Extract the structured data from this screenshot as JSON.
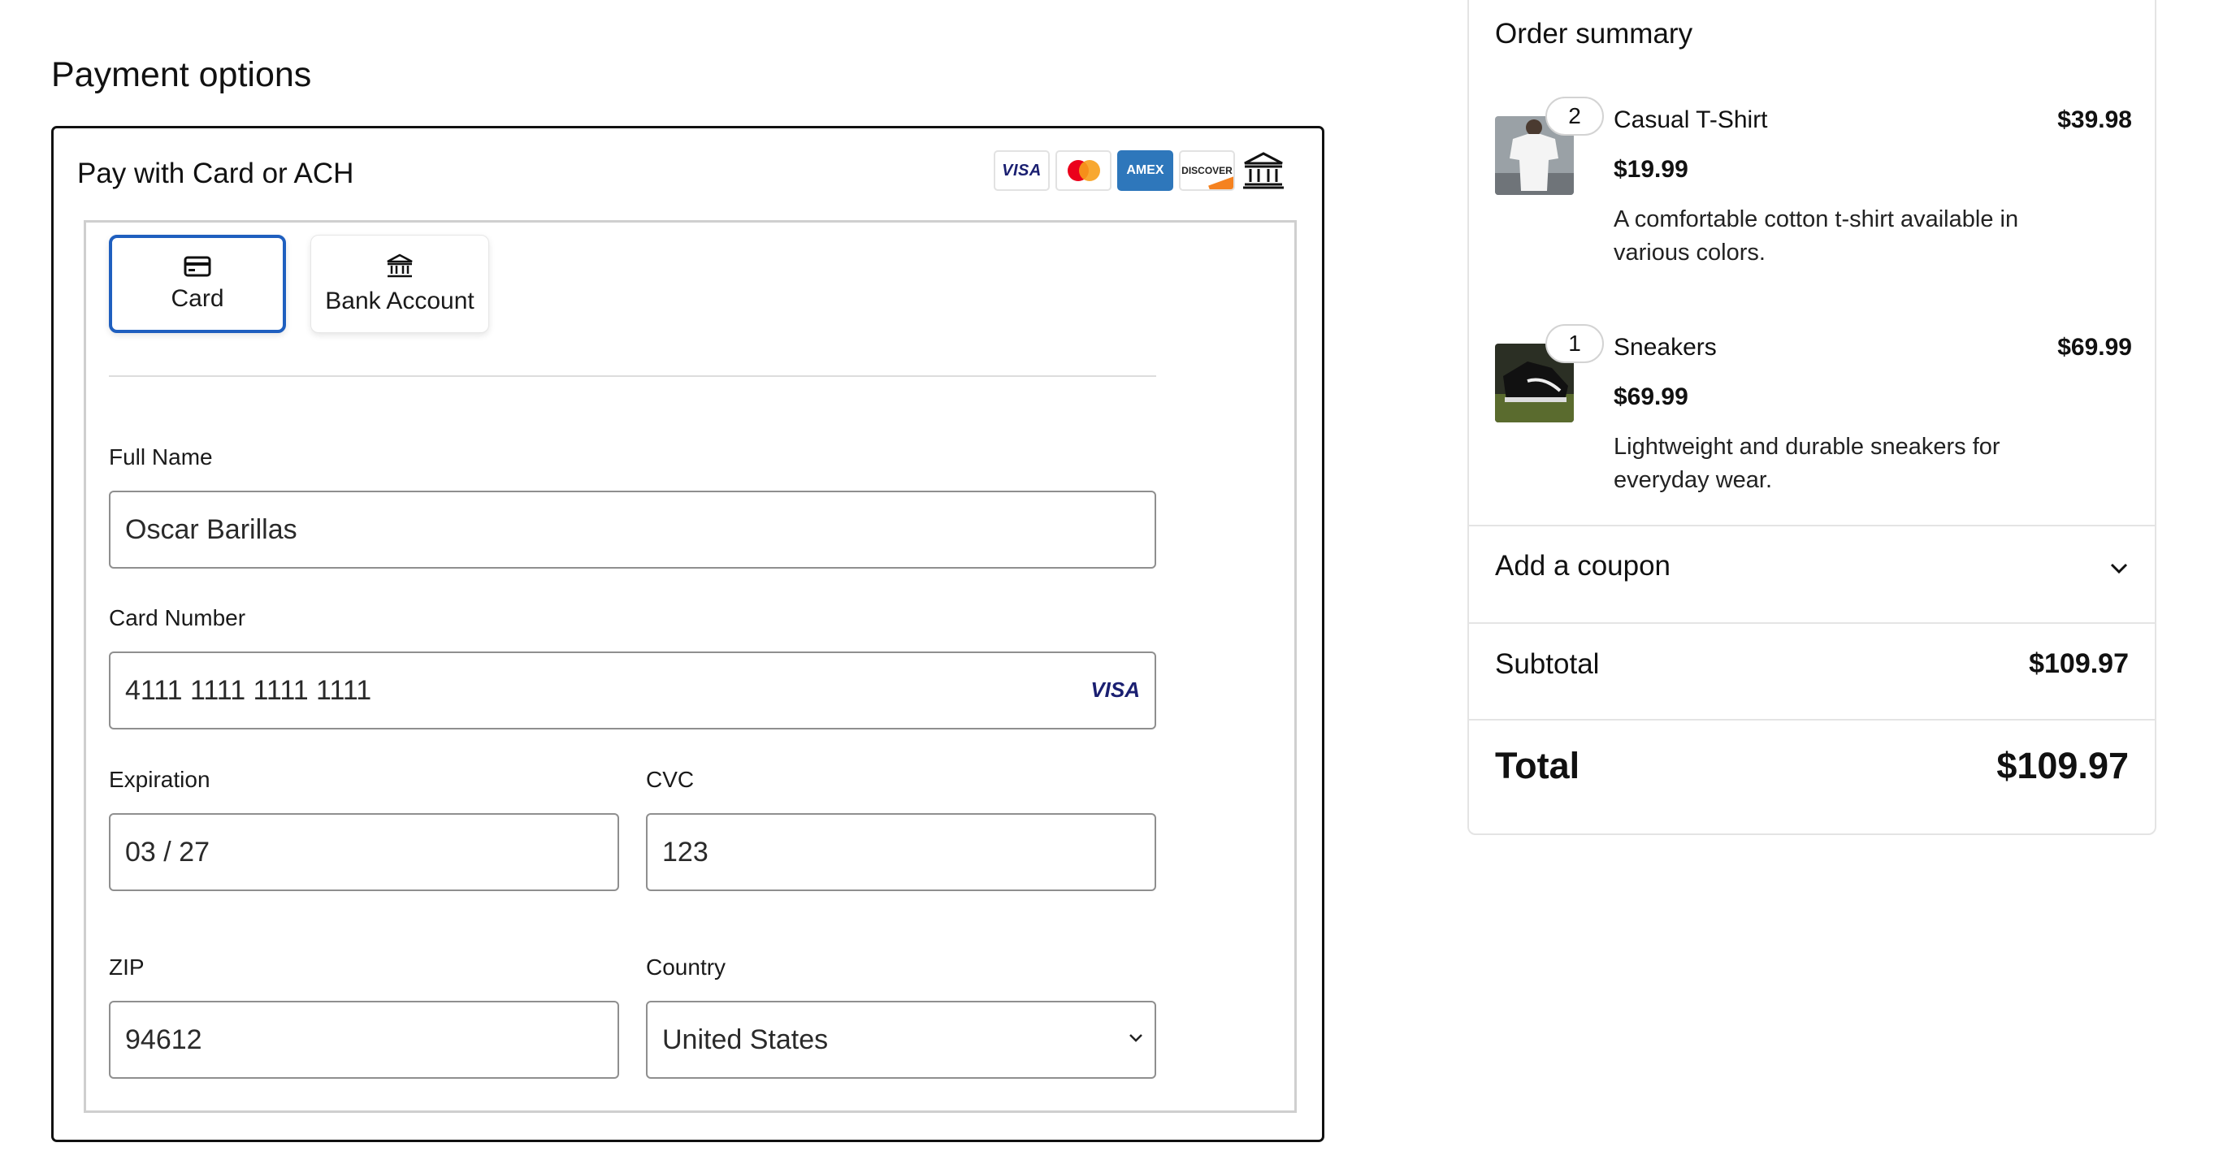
{
  "payment": {
    "title": "Payment options",
    "box_title": "Pay with Card or ACH",
    "brands": [
      {
        "name": "visa",
        "label": "VISA"
      },
      {
        "name": "mastercard",
        "label": ""
      },
      {
        "name": "amex",
        "label": "AMEX"
      },
      {
        "name": "discover",
        "label": "DISCOVER"
      },
      {
        "name": "bank",
        "label": ""
      }
    ],
    "tabs": [
      {
        "label": "Card",
        "icon": "credit-card-icon",
        "selected": true
      },
      {
        "label": "Bank Account",
        "icon": "bank-icon",
        "selected": false
      }
    ],
    "fields": {
      "full_name": {
        "label": "Full Name",
        "value": "Oscar Barillas"
      },
      "card_number": {
        "label": "Card Number",
        "value": "4111 1111 1111 1111",
        "brand": "VISA"
      },
      "expiration": {
        "label": "Expiration",
        "value": "03 / 27"
      },
      "cvc": {
        "label": "CVC",
        "value": "123"
      },
      "zip": {
        "label": "ZIP",
        "value": "94612"
      },
      "country": {
        "label": "Country",
        "value": "United States"
      }
    }
  },
  "summary": {
    "title": "Order summary",
    "items": [
      {
        "qty": "2",
        "name": "Casual T-Shirt",
        "total": "$39.98",
        "price": "$19.99",
        "description": "A comfortable cotton t-shirt available in various colors."
      },
      {
        "qty": "1",
        "name": "Sneakers",
        "total": "$69.99",
        "price": "$69.99",
        "description": "Lightweight and durable sneakers for everyday wear."
      }
    ],
    "coupon_label": "Add a coupon",
    "subtotal_label": "Subtotal",
    "subtotal_value": "$109.97",
    "total_label": "Total",
    "total_value": "$109.97"
  },
  "colors": {
    "accent": "#1f5fbf",
    "visa_blue": "#1a1f71",
    "amex_blue": "#2e77bb",
    "mastercard_red": "#eb001b",
    "mastercard_orange": "#f79e1b"
  }
}
